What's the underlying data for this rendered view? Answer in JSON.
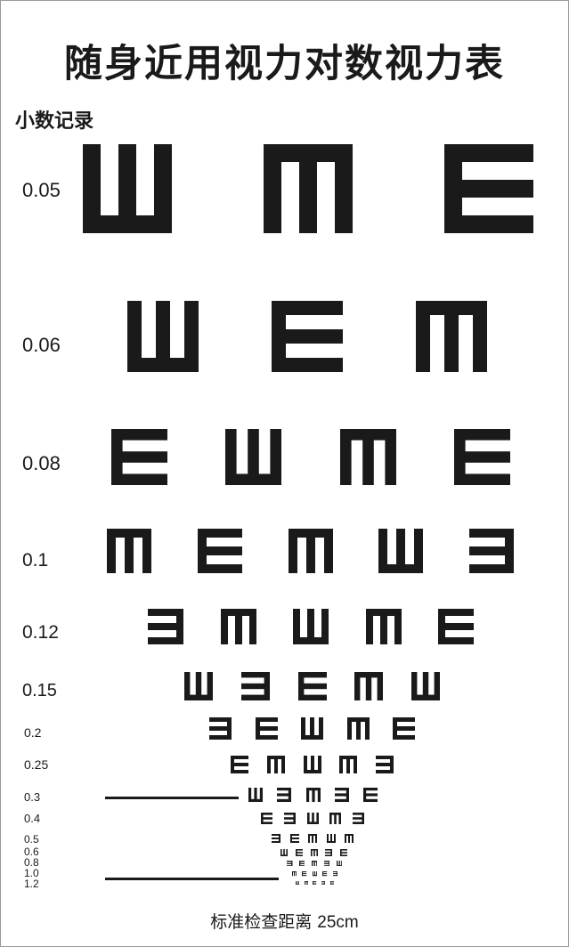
{
  "title": "随身近用视力对数视力表",
  "decimal_header": "小数记录",
  "ink_color": "#1a1a1a",
  "rows": [
    {
      "acuity": "0.05",
      "optotypes": [
        "up",
        "down",
        "right"
      ]
    },
    {
      "acuity": "0.06",
      "optotypes": [
        "up",
        "right",
        "down"
      ]
    },
    {
      "acuity": "0.08",
      "optotypes": [
        "right",
        "up",
        "down",
        "right"
      ]
    },
    {
      "acuity": "0.1",
      "optotypes": [
        "down",
        "right",
        "down",
        "up",
        "left"
      ]
    },
    {
      "acuity": "0.12",
      "optotypes": [
        "left",
        "down",
        "up",
        "down",
        "right"
      ]
    },
    {
      "acuity": "0.15",
      "optotypes": [
        "up",
        "left",
        "right",
        "down",
        "up"
      ]
    },
    {
      "acuity": "0.2",
      "optotypes": [
        "left",
        "right",
        "up",
        "down",
        "right"
      ]
    },
    {
      "acuity": "0.25",
      "optotypes": [
        "right",
        "down",
        "up",
        "down",
        "left"
      ]
    },
    {
      "acuity": "0.3",
      "optotypes": [
        "up",
        "left",
        "down",
        "left",
        "right"
      ]
    },
    {
      "acuity": "0.4",
      "optotypes": [
        "right",
        "left",
        "up",
        "down",
        "left"
      ]
    },
    {
      "acuity": "0.5",
      "optotypes": [
        "left",
        "right",
        "down",
        "up",
        "down"
      ]
    },
    {
      "acuity": "0.6",
      "optotypes": [
        "up",
        "right",
        "down",
        "left",
        "right"
      ]
    },
    {
      "acuity": "0.8",
      "optotypes": [
        "left",
        "right",
        "down",
        "left",
        "up"
      ]
    },
    {
      "acuity": "1.0",
      "optotypes": [
        "down",
        "right",
        "up",
        "right",
        "left"
      ]
    },
    {
      "acuity": "1.2",
      "optotypes": [
        "up",
        "down",
        "right",
        "left",
        "right"
      ]
    }
  ],
  "distance_label": "标准检查距离",
  "distance_value": "25cm"
}
